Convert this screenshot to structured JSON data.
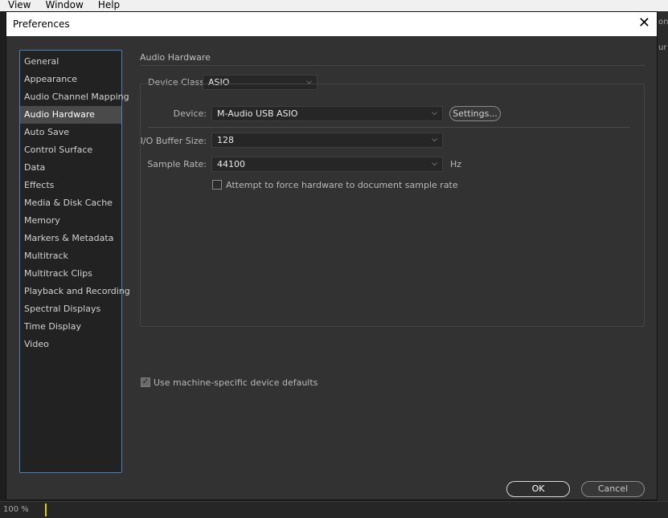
{
  "app_menu": [
    "View",
    "Window",
    "Help"
  ],
  "background": {
    "zoom": "100 %",
    "right_fragments": [
      "on",
      "ur"
    ]
  },
  "dialog": {
    "title": "Preferences",
    "close_glyph": "✕",
    "sidebar": [
      "General",
      "Appearance",
      "Audio Channel Mapping",
      "Audio Hardware",
      "Auto Save",
      "Control Surface",
      "Data",
      "Effects",
      "Media & Disk Cache",
      "Memory",
      "Markers & Metadata",
      "Multitrack",
      "Multitrack Clips",
      "Playback and Recording",
      "Spectral Displays",
      "Time Display",
      "Video"
    ],
    "selected_section": "Audio Hardware",
    "section_title": "Audio Hardware",
    "device_class": {
      "label": "Device Class:",
      "value": "ASIO"
    },
    "device": {
      "label": "Device:",
      "value": "M-Audio USB ASIO"
    },
    "settings_button": "Settings...",
    "buffer_size": {
      "label": "I/O Buffer Size:",
      "value": "128"
    },
    "sample_rate": {
      "label": "Sample Rate:",
      "value": "44100",
      "unit": "Hz"
    },
    "force_rate": {
      "label": "Attempt to force hardware to document sample rate",
      "checked": false
    },
    "machine_defaults": {
      "label": "Use machine-specific device defaults",
      "checked": true
    },
    "ok_label": "OK",
    "cancel_label": "Cancel"
  },
  "colors": {
    "accent_border": "#4d7fb8",
    "dialog_bg": "#323232",
    "selected_item": "#4a4a4a"
  }
}
